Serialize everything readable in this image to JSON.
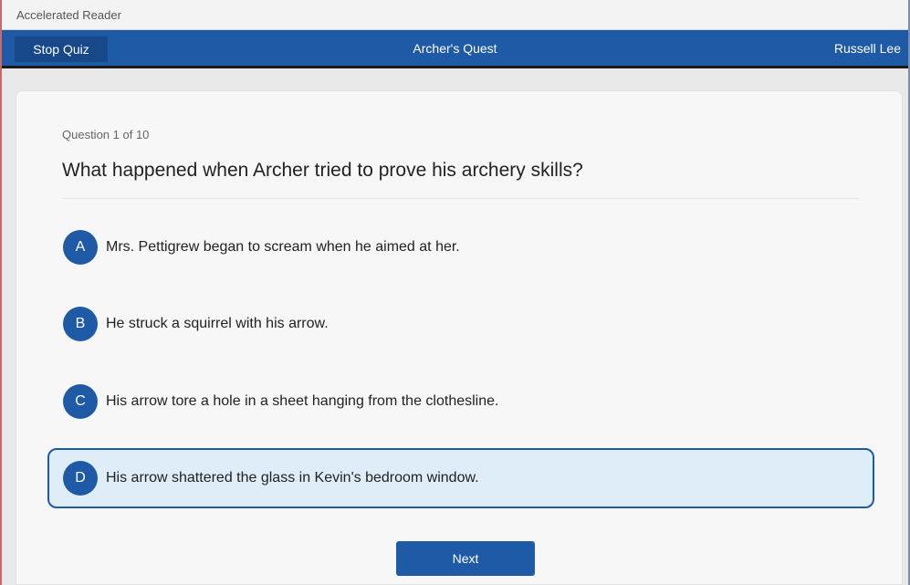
{
  "window": {
    "title": "Accelerated Reader"
  },
  "navbar": {
    "stop_label": "Stop Quiz",
    "quiz_title": "Archer's Quest",
    "user_name": "Russell Lee"
  },
  "question": {
    "number_text": "Question 1 of 10",
    "text": "What happened when Archer tried to prove his archery skills?"
  },
  "options": [
    {
      "letter": "A",
      "text": "Mrs. Pettigrew began to scream when he aimed at her.",
      "selected": false
    },
    {
      "letter": "B",
      "text": "He struck a squirrel with his arrow.",
      "selected": false
    },
    {
      "letter": "C",
      "text": "His arrow tore a hole in a sheet hanging from the clothesline.",
      "selected": false
    },
    {
      "letter": "D",
      "text": "His arrow shattered the glass in Kevin's bedroom window.",
      "selected": true
    }
  ],
  "footer": {
    "next_label": "Next"
  },
  "colors": {
    "primary": "#1f5aa6",
    "selected_bg": "#deedf8"
  }
}
